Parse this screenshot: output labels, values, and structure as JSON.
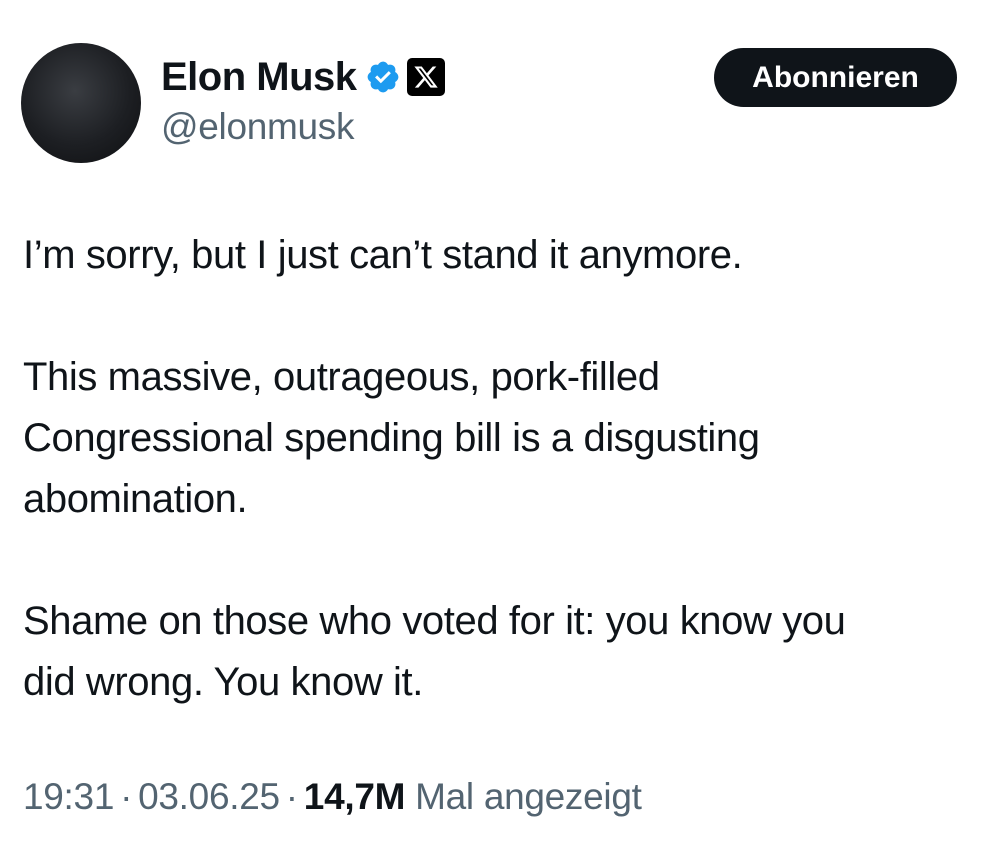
{
  "author": {
    "display_name": "Elon Musk",
    "handle": "@elonmusk",
    "verified_icon": "verified-badge-icon",
    "affiliation_icon": "x-logo-icon",
    "verified_color": "#1d9bf0"
  },
  "actions": {
    "subscribe_label": "Abonnieren"
  },
  "tweet": {
    "paragraphs": [
      "I’m sorry, but I just can’t stand it anymore.",
      "This massive, outrageous, pork-filled\nCongressional spending bill is a disgusting\nabomination.",
      "Shame on those who voted for it: you know you\ndid wrong. You know it."
    ]
  },
  "meta": {
    "time": "19:31",
    "separator": "·",
    "date": "03.06.25",
    "views_count": "14,7M",
    "views_label": "Mal angezeigt"
  }
}
